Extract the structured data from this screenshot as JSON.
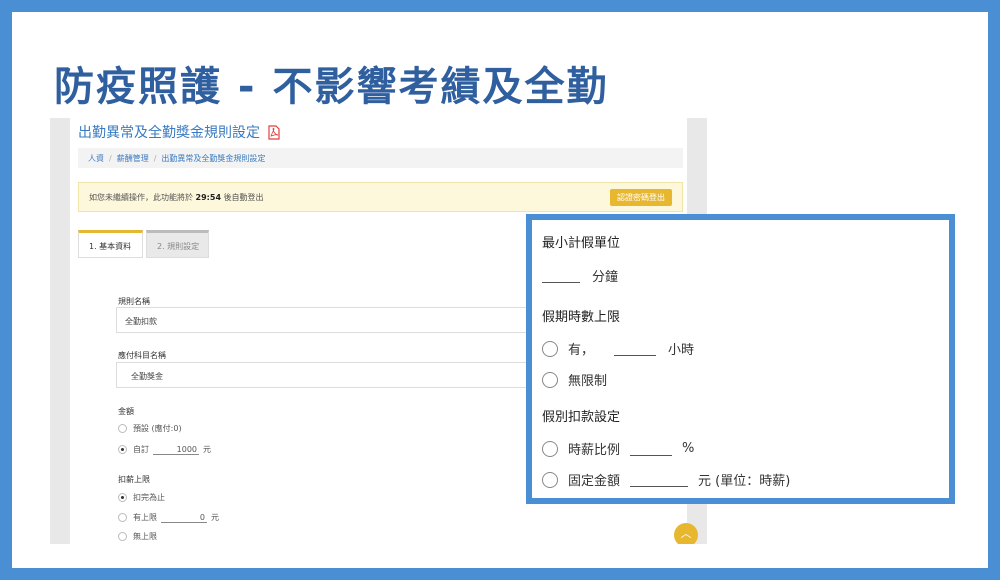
{
  "headline": "防疫照護 - 不影響考績及全勤",
  "page": {
    "title": "出勤異常及全勤獎金規則設定",
    "breadcrumb": [
      "人資",
      "薪酬管理",
      "出勤異常及全勤獎金規則設定"
    ],
    "alert_prefix": "如您未繼續操作，此功能將於",
    "alert_time": "29:54",
    "alert_suffix": "後自動登出",
    "alert_button": "認證密碼登出",
    "tabs": [
      "1. 基本資料",
      "2. 規則設定"
    ],
    "rule_name_label": "規則名稱",
    "rule_name_value": "全勤扣款",
    "payable_label": "應付科目名稱",
    "payable_value": "全勤獎金",
    "amount_label": "金額",
    "amount_default": "預設 (應付:0)",
    "amount_custom": "自訂",
    "amount_value": "1000",
    "amount_unit": "元",
    "deduct_label": "扣薪上限",
    "deduct_until": "扣完為止",
    "deduct_limit": "有上限",
    "deduct_limit_value": "0",
    "deduct_unit": "元",
    "deduct_none": "無上限",
    "scroll_top": "︿"
  },
  "callout": {
    "min_unit_heading": "最小計假單位",
    "min_unit_suffix": "分鐘",
    "hours_cap_heading": "假期時數上限",
    "hours_yes": "有，",
    "hours_unit": "小時",
    "hours_unlimited": "無限制",
    "deduction_heading": "假別扣款設定",
    "hourly_ratio": "時薪比例",
    "percent": "%",
    "fixed_amount": "固定金額",
    "fixed_unit": "元 (單位：時薪)"
  },
  "colors": {
    "accent": "#4a8fd4",
    "headline": "#2f5f9e",
    "link": "#3a7ac0",
    "warning": "#e8b730",
    "pdf": "#e04040"
  }
}
